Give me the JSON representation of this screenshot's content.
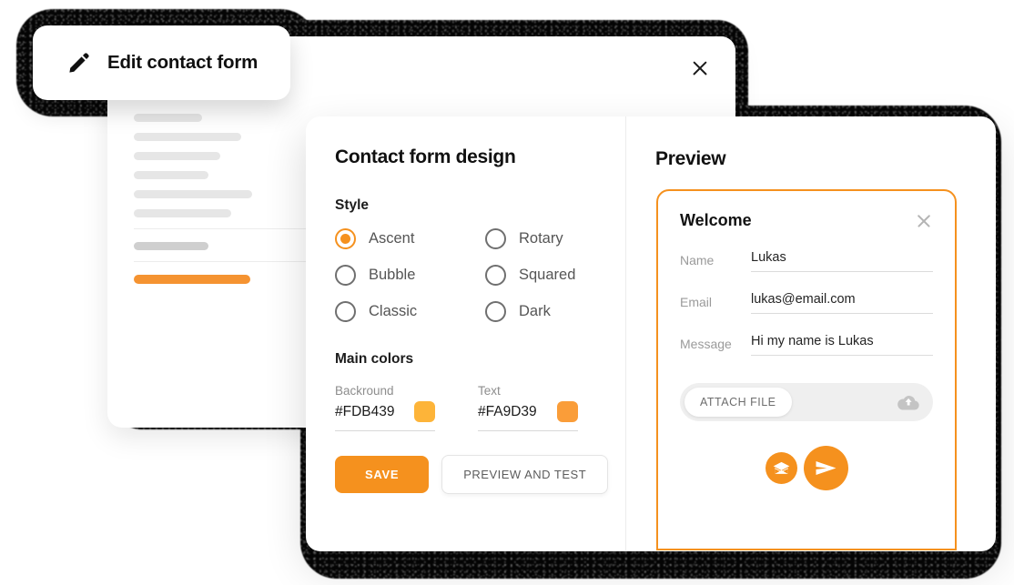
{
  "window": {
    "title": "Edit contact form",
    "title_icon": "pencil-icon",
    "close_icon": "close-icon"
  },
  "design_panel": {
    "heading": "Contact form design",
    "style_label": "Style",
    "style_options": [
      {
        "label": "Ascent",
        "selected": true
      },
      {
        "label": "Rotary",
        "selected": false
      },
      {
        "label": "Bubble",
        "selected": false
      },
      {
        "label": "Squared",
        "selected": false
      },
      {
        "label": "Classic",
        "selected": false
      },
      {
        "label": "Dark",
        "selected": false
      }
    ],
    "colors_label": "Main colors",
    "colors": [
      {
        "label": "Backround",
        "value": "#FDB439",
        "swatch": "#FDB439"
      },
      {
        "label": "Text",
        "value": "#FA9D39",
        "swatch": "#FA9D39"
      }
    ],
    "save_label": "SAVE",
    "preview_label": "PREVIEW AND TEST"
  },
  "preview_panel": {
    "heading": "Preview",
    "widget": {
      "title": "Welcome",
      "close_icon": "close-icon",
      "fields": [
        {
          "label": "Name",
          "value": "Lukas"
        },
        {
          "label": "Email",
          "value": "lukas@email.com"
        },
        {
          "label": "Message",
          "value": "Hi my name is Lukas"
        }
      ],
      "attach_label": "ATTACH FILE",
      "upload_icon": "cloud-upload-icon",
      "actions": [
        {
          "icon": "envelope-icon",
          "size": "small"
        },
        {
          "icon": "send-icon",
          "size": "large"
        }
      ]
    }
  },
  "theme": {
    "accent": "#F5911E",
    "skeleton_light": "#E6E6E6",
    "skeleton_dark": "#CFCFCF"
  }
}
